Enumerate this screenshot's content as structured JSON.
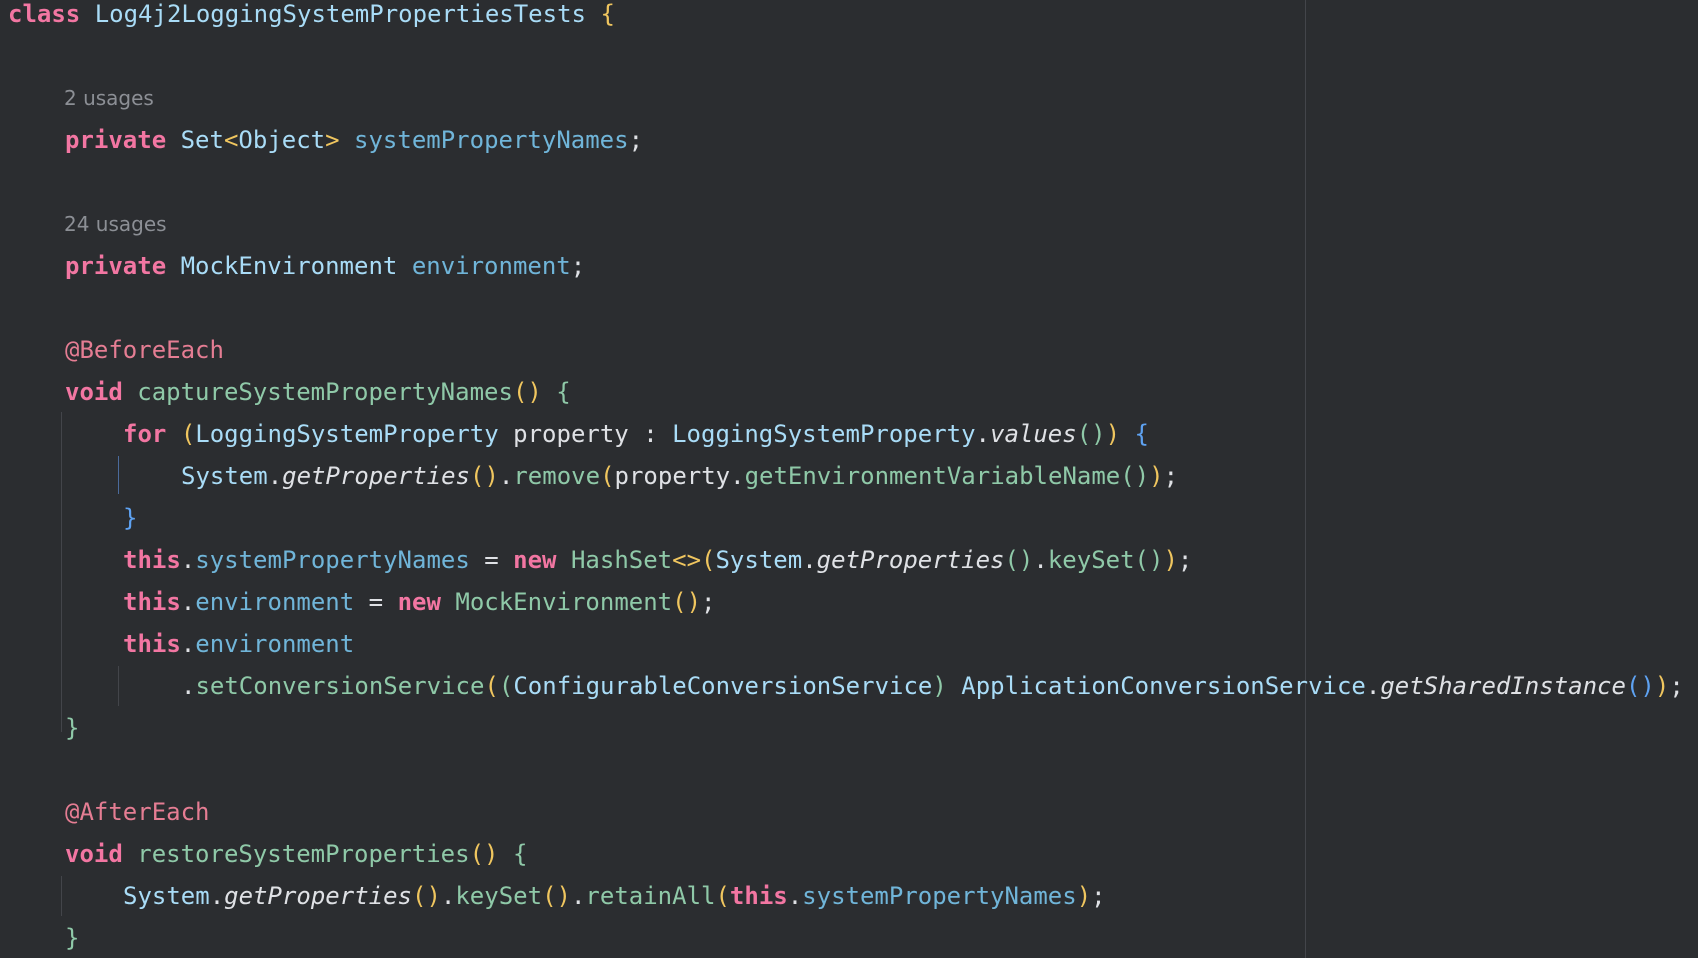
{
  "editor": {
    "language": "Java",
    "theme_colors": {
      "background": "#2b2d30",
      "keyword": "#f276a2",
      "class_name": "#a9dcf7",
      "field": "#70b5d9",
      "method": "#8fc9a8",
      "annotation": "#e57d93",
      "inlay_hint": "#8c8f95",
      "bracket_level_1": "#f0c65f",
      "bracket_level_2": "#8fc9a8",
      "bracket_level_3": "#5ea2f2"
    },
    "hints": {
      "usages_1": "2 usages",
      "usages_2": "24 usages"
    },
    "tokens": {
      "kw_class": "class",
      "class_name": "Log4j2LoggingSystemPropertiesTests",
      "brace_open": "{",
      "kw_private": "private",
      "type_set": "Set",
      "lt": "<",
      "type_object": "Object",
      "gt": ">",
      "field_system_property_names": "systemPropertyNames",
      "semi": ";",
      "type_mock_environment": "MockEnvironment",
      "field_environment": "environment",
      "annotation_before_each": "@BeforeEach",
      "kw_void": "void",
      "method_capture": "captureSystemPropertyNames",
      "parens": "()",
      "kw_for": "for",
      "paren_open": "(",
      "type_logging_system_property": "LoggingSystemProperty",
      "var_property": "property",
      "colon": ":",
      "dot": ".",
      "method_values": "values",
      "paren_close": ")",
      "type_system": "System",
      "method_get_properties": "getProperties",
      "method_remove": "remove",
      "method_get_env_var_name": "getEnvironmentVariableName",
      "brace_close": "}",
      "kw_this": "this",
      "assign": "=",
      "kw_new": "new",
      "type_hash_set": "HashSet",
      "diamond": "<>",
      "method_key_set": "keySet",
      "method_set_conversion_service": "setConversionService",
      "type_configurable_conversion_service": "ConfigurableConversionService",
      "type_application_conversion_service": "ApplicationConversionService",
      "method_get_shared_instance": "getSharedInstance",
      "annotation_after_each": "@AfterEach",
      "method_restore": "restoreSystemProperties",
      "method_retain_all": "retainAll"
    }
  }
}
